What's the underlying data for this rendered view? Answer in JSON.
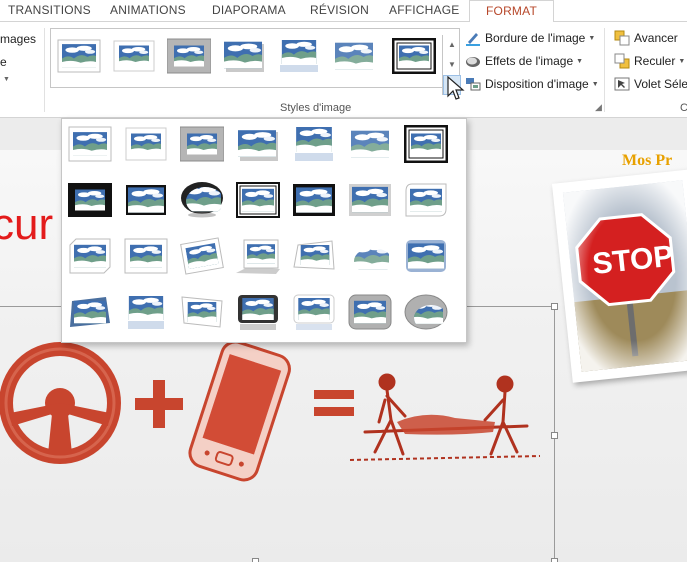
{
  "tabs": [
    "TRANSITIONS",
    "ANIMATIONS",
    "DIAPORAMA",
    "RÉVISION",
    "AFFICHAGE",
    "FORMAT"
  ],
  "active_tab": "FORMAT",
  "ribbon": {
    "left_cut_1": "mages",
    "left_cut_2": "e",
    "group_label": "Styles d'image",
    "picture_border": "Bordure de l'image",
    "picture_effects": "Effets de l'image",
    "picture_layout": "Disposition d'image",
    "bring_forward": "Avancer",
    "send_backward": "Reculer",
    "selection_pane": "Volet Sélec",
    "next_group_cut": "C"
  },
  "gallery_style_names": [
    "simple-frame-white",
    "beveled-matte-white",
    "metal-frame",
    "drop-shadow-rectangle",
    "reflected-rounded-rectangle",
    "soft-edge-rectangle",
    "double-frame-black"
  ],
  "dropdown_style_names": [
    [
      "simple-frame-white",
      "beveled-matte-white",
      "metal-frame",
      "drop-shadow-rectangle",
      "reflected-rounded-rectangle",
      "soft-edge-rectangle",
      "double-frame-black"
    ],
    [
      "thick-matte-black",
      "simple-frame-black",
      "beveled-oval-black",
      "compound-frame-black",
      "moderate-frame-black",
      "center-shadow-rectangle",
      "rounded-diagonal-corner-white"
    ],
    [
      "snip-diagonal-corner-white",
      "moderate-frame-white",
      "rotated-white",
      "perspective-shadow-white",
      "relaxed-perspective-white",
      "soft-edge-oval",
      "bevel-rectangle"
    ],
    [
      "bevel-perspective",
      "reflected-perspective-right",
      "bevel-perspective-left-white",
      "reflected-bevel-black",
      "reflected-bevel-white",
      "metal-rounded-rectangle",
      "metal-oval"
    ]
  ],
  "slide": {
    "big_text_cut": "cur",
    "title_cut": "Mos Pr",
    "stop_sign": "STOP"
  },
  "colors": {
    "accent": "#b7472a",
    "slide_red": "#e31b1b",
    "title_orange": "#e8a100",
    "sky": "#4a7bb7",
    "hill": "#6d9f89"
  }
}
